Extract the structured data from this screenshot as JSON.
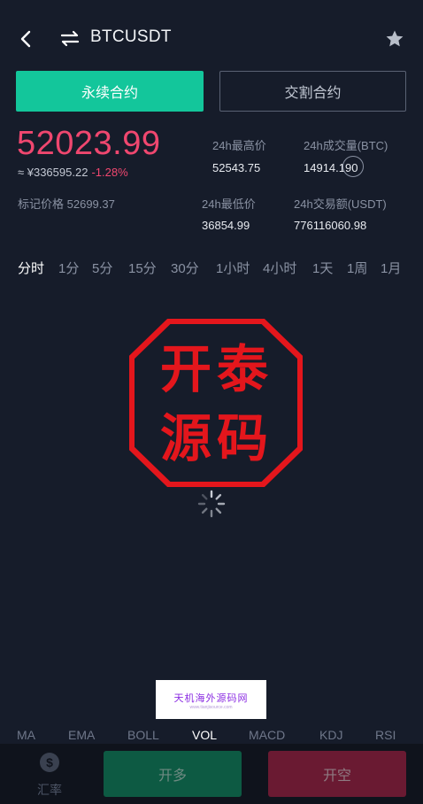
{
  "header": {
    "title": "BTCUSDT"
  },
  "tabs": {
    "perpetual": "永续合约",
    "delivery": "交割合约"
  },
  "price": {
    "last": "52023.99",
    "cny": "≈ ¥336595.22",
    "change": "-1.28%",
    "mark_label": "标记价格",
    "mark_value": "52699.37"
  },
  "stats": {
    "high_label": "24h最高价",
    "high_value": "52543.75",
    "vol_label": "24h成交量(BTC)",
    "vol_value": "14914.190",
    "low_label": "24h最低价",
    "low_value": "36854.99",
    "turnover_label": "24h交易额(USDT)",
    "turnover_value": "776116060.98"
  },
  "time_tabs": [
    "分时",
    "1分",
    "5分",
    "15分",
    "30分",
    "1小时",
    "4小时",
    "1天",
    "1周",
    "1月"
  ],
  "active_time_tab": "分时",
  "stamp": {
    "text": "开泰源码"
  },
  "watermark": {
    "text": "天机海外源码网",
    "sub": "www.tianjisource.com"
  },
  "indicators": [
    "MA",
    "EMA",
    "BOLL",
    "VOL",
    "MACD",
    "KDJ",
    "RSI"
  ],
  "active_indicator": "VOL",
  "bottom": {
    "rate_label": "汇率",
    "rate_icon": "dollar-icon",
    "long_label": "开多",
    "short_label": "开空"
  },
  "colors": {
    "background": "#161c2a",
    "accent_green": "#13c69b",
    "price_red": "#f0476f",
    "long_button": "#0d5a43",
    "short_button": "#6a1a32",
    "stamp_red": "#e4161c"
  }
}
